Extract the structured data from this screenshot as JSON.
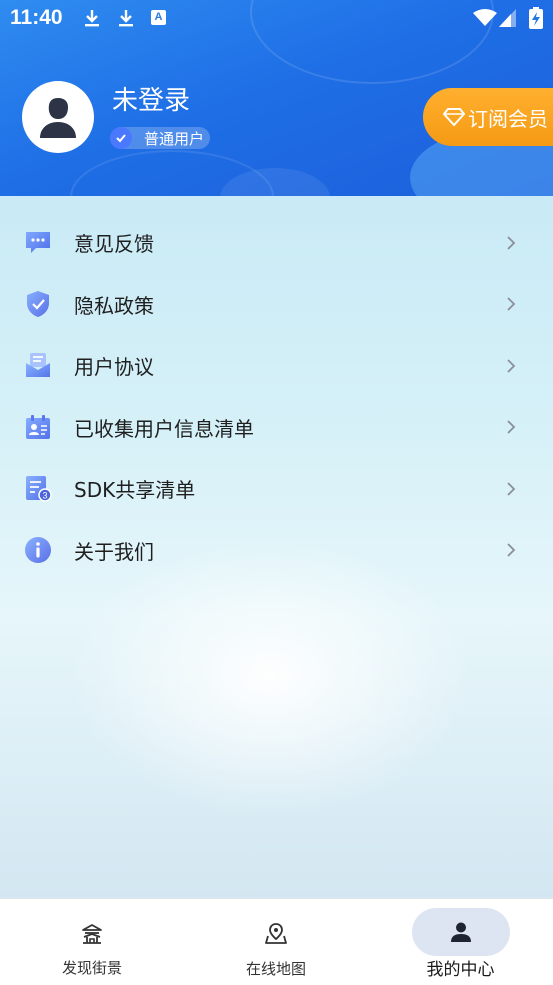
{
  "status_bar": {
    "time": "11:40",
    "a_badge": "A"
  },
  "header": {
    "user_name": "未登录",
    "user_badge": "普通用户",
    "vip_button": "订阅会员"
  },
  "menu": {
    "items": [
      {
        "label": "意见反馈",
        "icon": "feedback-icon"
      },
      {
        "label": "隐私政策",
        "icon": "shield-icon"
      },
      {
        "label": "用户协议",
        "icon": "agreement-icon"
      },
      {
        "label": "已收集用户信息清单",
        "icon": "id-card-icon"
      },
      {
        "label": "SDK共享清单",
        "icon": "sdk-list-icon"
      },
      {
        "label": "关于我们",
        "icon": "info-icon"
      }
    ]
  },
  "bottom_nav": {
    "items": [
      {
        "label": "发现街景",
        "icon": "pagoda-icon"
      },
      {
        "label": "在线地图",
        "icon": "map-pin-icon"
      },
      {
        "label": "我的中心",
        "icon": "user-icon",
        "active": true
      }
    ]
  },
  "colors": {
    "accent": "#1f6fe6",
    "vip": "#f7a11c",
    "active_tab_bg": "#dde5f2"
  }
}
